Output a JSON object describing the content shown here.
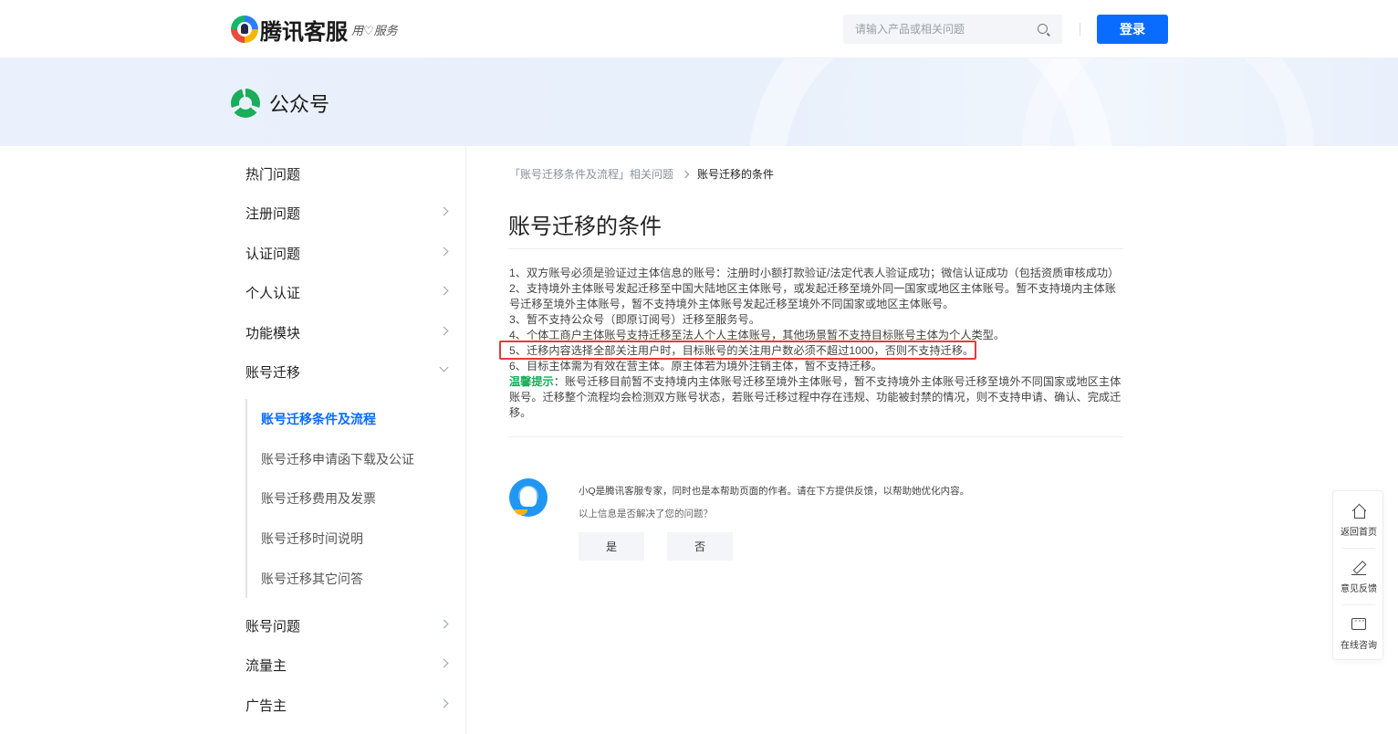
{
  "header": {
    "logo_text": "腾讯客服",
    "logo_slogan": "用♡服务",
    "search_placeholder": "请输入产品或相关问题",
    "login_label": "登录"
  },
  "banner": {
    "product_name": "公众号"
  },
  "sidebar": {
    "items": [
      {
        "label": "热门问题"
      },
      {
        "label": "注册问题"
      },
      {
        "label": "认证问题"
      },
      {
        "label": "个人认证"
      },
      {
        "label": "功能模块"
      },
      {
        "label": "账号迁移"
      },
      {
        "label": "账号问题"
      },
      {
        "label": "流量主"
      },
      {
        "label": "广告主"
      }
    ],
    "sub_items": [
      {
        "label": "账号迁移条件及流程",
        "active": true
      },
      {
        "label": "账号迁移申请函下载及公证"
      },
      {
        "label": "账号迁移费用及发票"
      },
      {
        "label": "账号迁移时间说明"
      },
      {
        "label": "账号迁移其它问答"
      }
    ]
  },
  "breadcrumb": {
    "parent": "「账号迁移条件及流程」相关问题",
    "current": "账号迁移的条件"
  },
  "article": {
    "title": "账号迁移的条件",
    "lines": [
      "1、双方账号必须是验证过主体信息的账号：注册时小额打款验证/法定代表人验证成功；微信认证成功（包括资质审核成功）",
      "2、支持境外主体账号发起迁移至中国大陆地区主体账号，或发起迁移至境外同一国家或地区主体账号。暂不支持境内主体账号迁移至境外主体账号，暂不支持境外主体账号发起迁移至境外不同国家或地区主体账号。",
      "3、暂不支持公众号（即原订阅号）迁移至服务号。",
      "4、个体工商户主体账号支持迁移至法人个人主体账号，其他场景暂不支持目标账号主体为个人类型。",
      "5、迁移内容选择全部关注用户时，目标账号的关注用户数必须不超过1000，否则不支持迁移。",
      "6、目标主体需为有效在营主体。原主体若为境外注销主体，暂不支持迁移。"
    ],
    "tip_label": "温馨提示",
    "tip_text": "：账号迁移目前暂不支持境内主体账号迁移至境外主体账号，暂不支持境外主体账号迁移至境外不同国家或地区主体账号。迁移整个流程均会检测双方账号状态，若账号迁移过程中存在违规、功能被封禁的情况，则不支持申请、确认、完成迁移。"
  },
  "feedback": {
    "intro": "小Q是腾讯客服专家，同时也是本帮助页面的作者。请在下方提供反馈，以帮助她优化内容。",
    "question": "以上信息是否解决了您的问题？",
    "yes_label": "是",
    "no_label": "否"
  },
  "float_panel": {
    "home_label": "返回首页",
    "feedback_label": "意见反馈",
    "consult_label": "在线咨询"
  },
  "colors": {
    "accent": "#0a6cff",
    "tip_green": "#1aad5a",
    "highlight_red": "#e53a3a"
  }
}
